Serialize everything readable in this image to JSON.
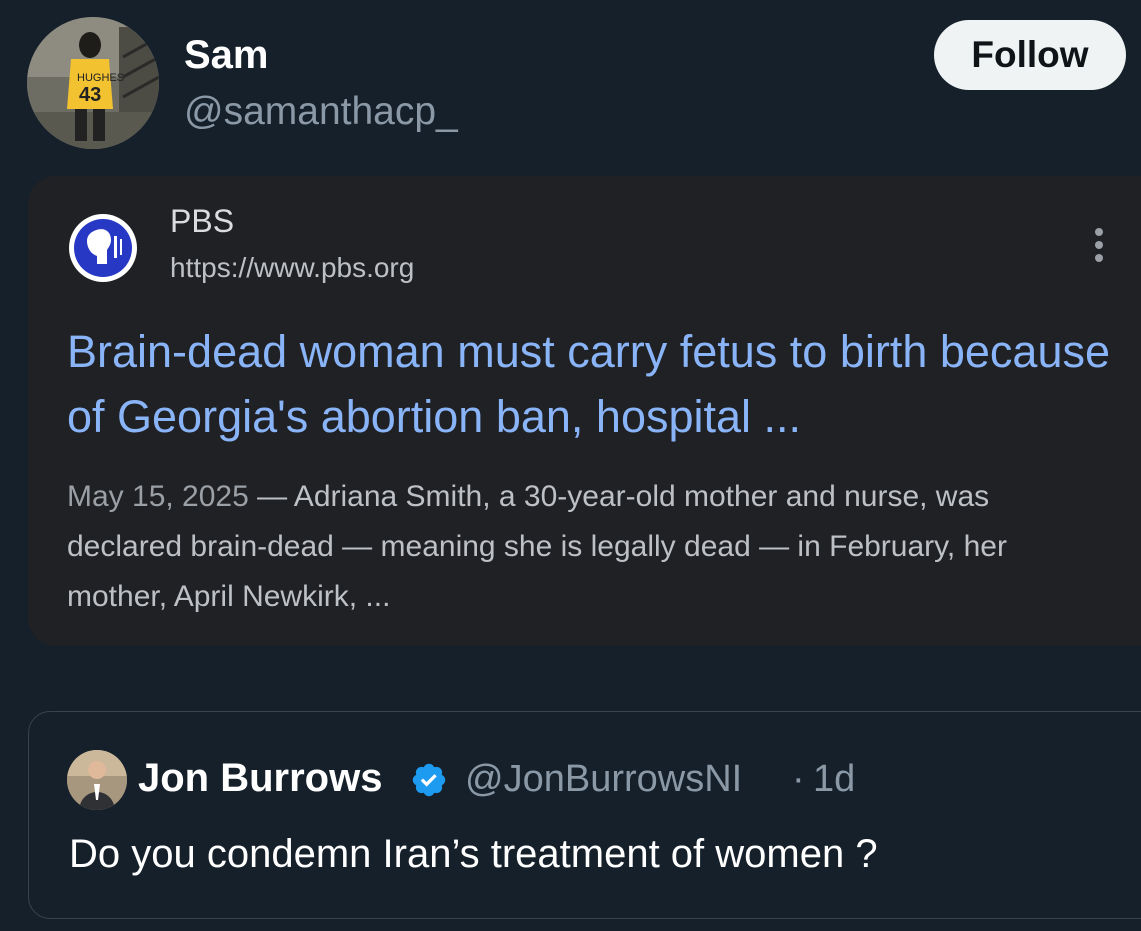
{
  "tweet": {
    "author_name": "Sam",
    "author_handle": "@samanthacp_",
    "follow_label": "Follow"
  },
  "search_result": {
    "source_name": "PBS",
    "source_url": "https://www.pbs.org",
    "title": "Brain-dead woman must carry fetus to birth because of Georgia's abortion ban, hospital ...",
    "date": "May 15, 2025",
    "snippet": " — Adriana Smith, a 30-year-old mother and nurse, was declared brain-dead — meaning she is legally dead — in February, her mother, April Newkirk, ...",
    "icons": {
      "logo": "pbs-logo-icon",
      "menu": "more-vertical-icon"
    }
  },
  "quoted_tweet": {
    "author_name": "Jon Burrows",
    "author_handle": "@JonBurrowsNI",
    "separator": "·",
    "time": "1d",
    "text": "Do you condemn Iran’s treatment of women ?",
    "icons": {
      "verified": "verified-badge-icon"
    }
  },
  "colors": {
    "background": "#15202b",
    "card_background": "#202124",
    "link_blue": "#8ab4f8",
    "verified_blue": "#1d9bf0",
    "follow_button_bg": "#eff3f4"
  }
}
